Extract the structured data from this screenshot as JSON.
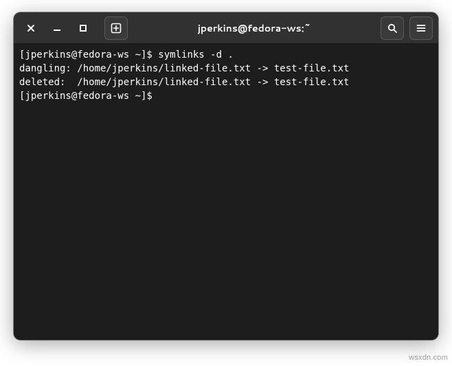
{
  "titlebar": {
    "title": "jperkins@fedora-ws:~"
  },
  "icons": {
    "close": "close-icon",
    "minimize": "minimize-icon",
    "maximize": "maximize-icon",
    "new_tab": "new-tab-icon",
    "search": "search-icon",
    "menu": "hamburger-icon"
  },
  "terminal": {
    "lines": [
      {
        "prompt": "[jperkins@fedora-ws ~]$ ",
        "command": "symlinks -d ."
      },
      {
        "text": "dangling: /home/jperkins/linked-file.txt -> test-file.txt"
      },
      {
        "text": "deleted:  /home/jperkins/linked-file.txt -> test-file.txt"
      },
      {
        "prompt": "[jperkins@fedora-ws ~]$ ",
        "command": ""
      }
    ]
  },
  "watermark": "wsxdn.com"
}
